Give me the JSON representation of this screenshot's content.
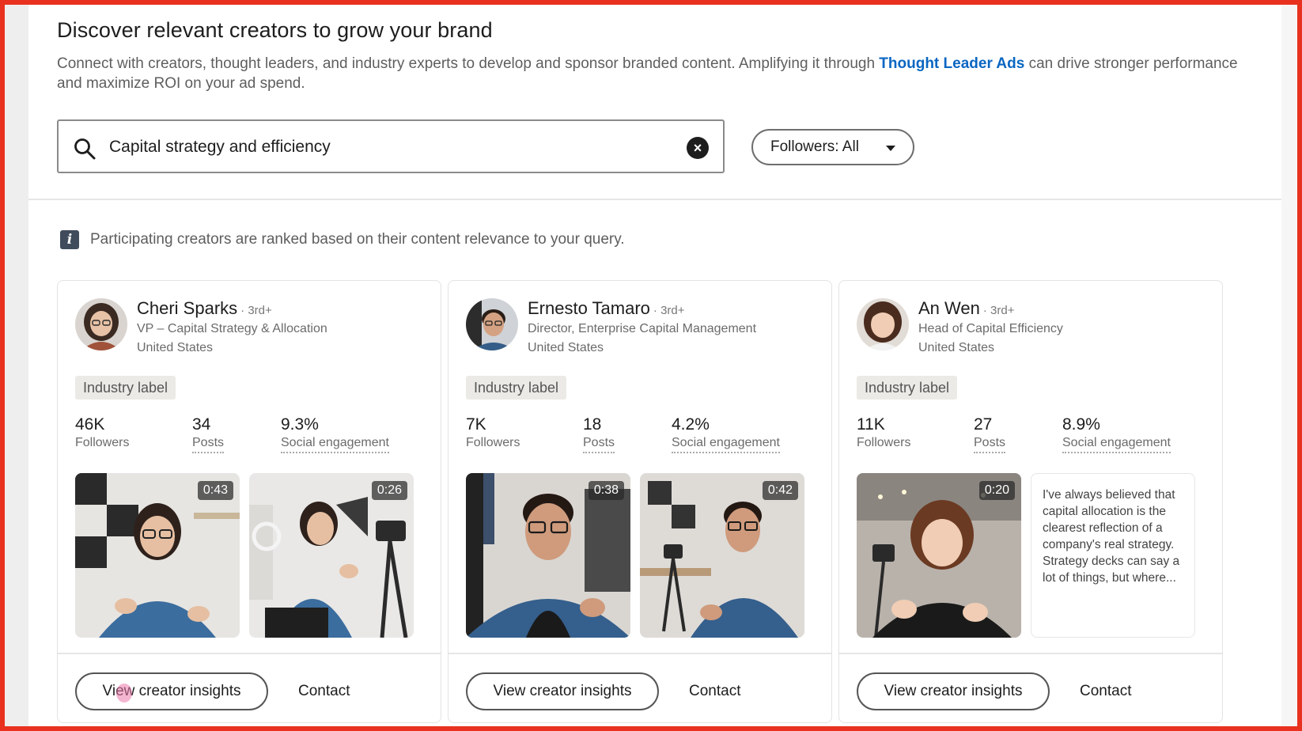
{
  "header": {
    "title": "Discover relevant creators to grow your brand",
    "subtitle_before": "Connect with creators, thought leaders, and industry experts to develop and sponsor branded content. Amplifying it through ",
    "subtitle_link": "Thought Leader Ads",
    "subtitle_after": " can drive stronger performance and maximize ROI on your ad spend."
  },
  "search": {
    "value": "Capital strategy and efficiency",
    "icon": "search-icon",
    "clear_icon": "clear-icon"
  },
  "filter": {
    "label": "Followers: All",
    "icon": "caret-down-icon"
  },
  "notice": {
    "icon": "info-icon",
    "text": "Participating creators are ranked based on their content relevance to your query."
  },
  "cards": [
    {
      "name": "Cheri Sparks",
      "degree": "· 3rd+",
      "role": "VP – Capital Strategy & Allocation",
      "location": "United States",
      "industry": "Industry label",
      "followers": "46K",
      "followers_label": "Followers",
      "posts": "34",
      "posts_label": "Posts",
      "engagement": "9.3%",
      "engagement_label": "Social engagement",
      "video1_duration": "0:43",
      "video2_duration": "0:26",
      "insights_label": "View creator insights",
      "contact_label": "Contact"
    },
    {
      "name": "Ernesto Tamaro",
      "degree": "· 3rd+",
      "role": "Director, Enterprise Capital Management",
      "location": "United States",
      "industry": "Industry label",
      "followers": "7K",
      "followers_label": "Followers",
      "posts": "18",
      "posts_label": "Posts",
      "engagement": "4.2%",
      "engagement_label": "Social engagement",
      "video1_duration": "0:38",
      "video2_duration": "0:42",
      "insights_label": "View creator insights",
      "contact_label": "Contact"
    },
    {
      "name": "An Wen",
      "degree": "· 3rd+",
      "role": "Head of Capital Efficiency",
      "location": "United States",
      "industry": "Industry label",
      "followers": "11K",
      "followers_label": "Followers",
      "posts": "27",
      "posts_label": "Posts",
      "engagement": "8.9%",
      "engagement_label": "Social engagement",
      "video1_duration": "0:20",
      "quote": "I've always believed that capital allocation is the clearest reflection of a company's real strategy. Strategy decks can say a lot of things, but where...",
      "insights_label": "View creator insights",
      "contact_label": "Contact"
    }
  ],
  "colors": {
    "frame": "#e8321f",
    "link": "#0a66c2",
    "text": "#1d1d1d",
    "muted": "#6b6b6b"
  }
}
